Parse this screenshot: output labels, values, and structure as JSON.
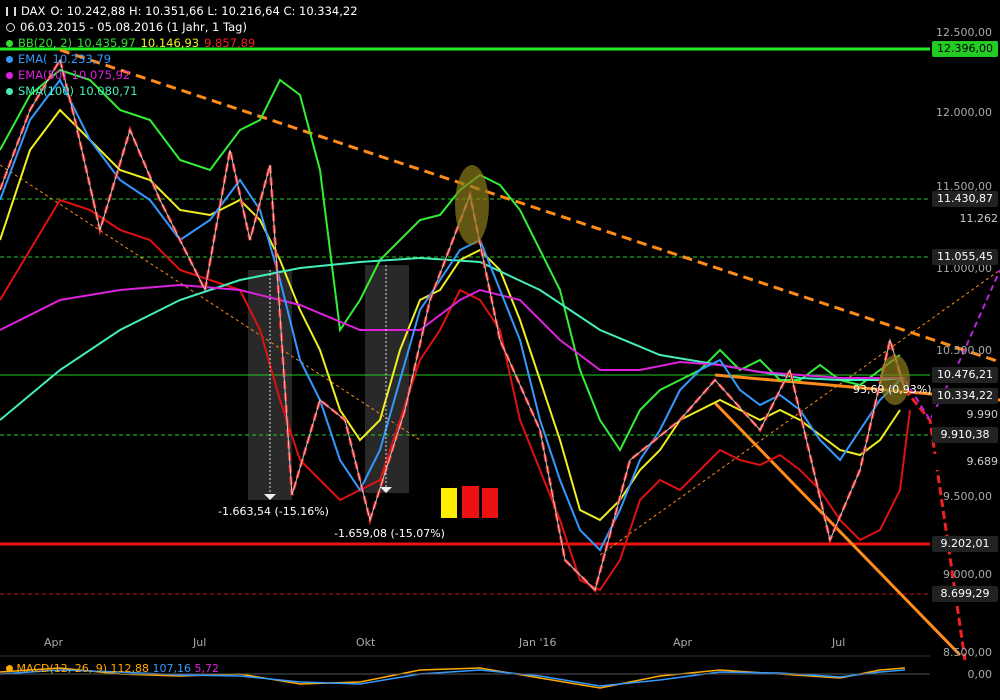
{
  "legend": {
    "symbol": "DAX",
    "ohlc": "O: 10.242,88  H: 10.351,66  L: 10.216,64  C: 10.334,22",
    "range": "06.03.2015 - 05.08.2016 (1 Jahr, 1 Tag)",
    "bb": {
      "label": "BB(20, 2)",
      "v1": "10.435,97",
      "v2": "10.146,93",
      "v3": "9.857,89",
      "color": "#33dd33"
    },
    "ema": {
      "label": "EMA(",
      "value": "10.233,79",
      "color": "#3399ff"
    },
    "ema2": {
      "label": "EMA(50)",
      "value": "10.075,92",
      "color": "#dd22dd"
    },
    "sma": {
      "label": "SMA(100)",
      "value": "10.080,71",
      "color": "#44eebb"
    }
  },
  "macd": {
    "label": "MACD(12, 26, 9)",
    "v1": "112,88",
    "v2": "107,16",
    "v3": "5,72"
  },
  "y_axis": {
    "ticks": [
      "12.500,00",
      "12.000,00",
      "11.500,00",
      "11.000,00",
      "10.500,00",
      "10.000,00",
      "9.500,00",
      "9.000,00",
      "8.500,00"
    ],
    "macd_zero": "0,00"
  },
  "x_axis": {
    "ticks": [
      "Apr",
      "Jul",
      "Okt",
      "Jan '16",
      "Apr",
      "Jul"
    ]
  },
  "price_boxes": [
    {
      "label": "12.396,00",
      "bg": "#22cc22",
      "fg": "#000"
    },
    {
      "label": "11.430,87",
      "bg": "#222",
      "fg": "#fff"
    },
    {
      "label": "11.262",
      "bg": "#000",
      "fg": "#ccc"
    },
    {
      "label": "11.055,45",
      "bg": "#222",
      "fg": "#fff"
    },
    {
      "label": "10.476,21",
      "bg": "#222",
      "fg": "#fff"
    },
    {
      "label": "10.334,22",
      "bg": "#222",
      "fg": "#fff"
    },
    {
      "label": "9.990",
      "bg": "#000",
      "fg": "#ccc"
    },
    {
      "label": "9.910,38",
      "bg": "#222",
      "fg": "#fff"
    },
    {
      "label": "9.689",
      "bg": "#000",
      "fg": "#ccc"
    },
    {
      "label": "9.202,01",
      "bg": "#222",
      "fg": "#fff"
    },
    {
      "label": "8.699,29",
      "bg": "#222",
      "fg": "#fff"
    }
  ],
  "annotations": {
    "drop1": "-1.663,54 (-15.16%)",
    "drop2": "-1.659,08 (-15.07%)",
    "gain": "93,69 (0,93%)"
  },
  "chart_data": {
    "type": "line",
    "title": "DAX",
    "x": [
      "Apr",
      "Jul",
      "Okt",
      "Jan '16",
      "Apr",
      "Jul"
    ],
    "ylim": [
      8500,
      12600
    ],
    "series": [
      {
        "name": "DAX",
        "values": [
          12000,
          11400,
          10100,
          10750,
          8700,
          10000,
          9300,
          10334
        ]
      },
      {
        "name": "SMA(100)",
        "values": [
          11600,
          11300,
          11100,
          10900,
          10300,
          10100,
          10050,
          10080
        ]
      },
      {
        "name": "EMA(50)",
        "values": [
          11800,
          11350,
          10900,
          10700,
          10200,
          10150,
          10000,
          10075
        ]
      }
    ],
    "levels": [
      12396.0,
      11430.87,
      11055.45,
      10476.21,
      10334.22,
      9910.38,
      9202.01,
      8699.29
    ]
  }
}
